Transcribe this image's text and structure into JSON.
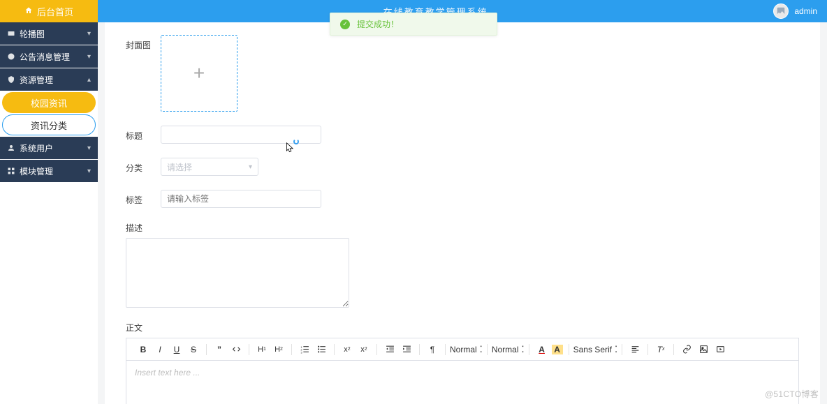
{
  "header": {
    "home_tab": "后台首页",
    "title": "在线教育教学管理系统",
    "username": "admin"
  },
  "toast": {
    "message": "提交成功！"
  },
  "sidebar": {
    "items": [
      {
        "label": "轮播图"
      },
      {
        "label": "公告消息管理"
      },
      {
        "label": "资源管理"
      },
      {
        "label": "系统用户"
      },
      {
        "label": "模块管理"
      }
    ],
    "sub": {
      "campus_label": "校园资讯",
      "category_label": "资讯分类"
    }
  },
  "form": {
    "cover_label": "封面图",
    "title_label": "标题",
    "title_value": "",
    "category_label": "分类",
    "category_placeholder": "请选择",
    "tag_label": "标签",
    "tag_placeholder": "请输入标签",
    "tag_value": "",
    "desc_label": "描述",
    "desc_value": "",
    "content_label": "正文",
    "editor_placeholder": "Insert text here ..."
  },
  "editor_toolbar": {
    "font_select": "Normal",
    "size_select": "Normal",
    "family_select": "Sans Serif"
  },
  "watermark": "@51CTO博客"
}
